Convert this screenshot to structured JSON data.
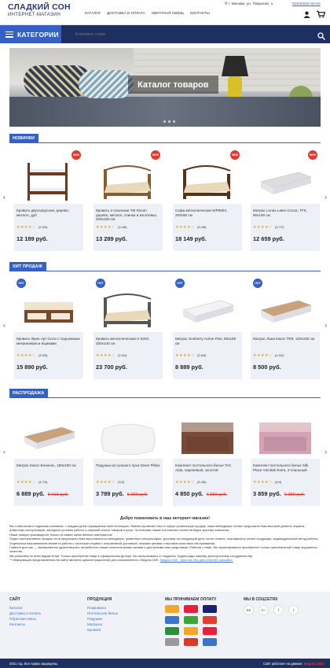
{
  "header": {
    "logo_title": "СЛАДКИЙ СОН",
    "logo_subtitle": "ИНТЕРНЕТ-МАГАЗИН",
    "nav": [
      "Каталог",
      "Доставка и оплата",
      "Обратная связь",
      "Контакты"
    ],
    "address": "г. Москва, ул. Тверская, 1.",
    "phone": "8(555)555-55-55"
  },
  "bar": {
    "categories_label": "КАТЕГОРИИ",
    "search_placeholder": "Ключевое слово"
  },
  "banner": {
    "title": "Каталог товаров"
  },
  "sections": [
    {
      "title": "НОВИНКИ",
      "badge": "NEW",
      "products": [
        {
          "name": "Кровать двухъярусная, дерево, металл, дуб",
          "rating": "★★★★☆",
          "reviews": "(2.5/4)",
          "price": "12 189 руб.",
          "old": ""
        },
        {
          "name": "Кровать 2-спальная ТМ Ricom дерево, металл, спинка и изголовье, 200x160 см",
          "rating": "★★★★☆",
          "reviews": "(3.4/8)",
          "price": "13 289 руб.",
          "old": ""
        },
        {
          "name": "Софа металлическая WP9003, 200х90 см",
          "rating": "★★★★☆",
          "reviews": "(3.4/8)",
          "price": "18 149 руб.",
          "old": ""
        },
        {
          "name": "Матрас Lonax Latex-Cocos, ТFK, 90х190 см",
          "rating": "★★★★☆",
          "reviews": "(3.7/7)",
          "price": "12 659 руб.",
          "old": ""
        }
      ]
    },
    {
      "title": "ХИТ ПРОДАЖ",
      "badge": "HOT",
      "products": [
        {
          "name": "Кровать Фран Арт-Сити с подъемным механизмом и ящиками",
          "rating": "★★★★☆",
          "reviews": "(3.5/5)",
          "price": "15 890 руб.",
          "old": ""
        },
        {
          "name": "Кровать металлическая Н 9203, 200х140 см",
          "rating": "★★★★☆",
          "reviews": "(3.3/4)",
          "price": "23 700 руб.",
          "old": ""
        },
        {
          "name": "Матрас Sonberry Active Plus, 90х195 см",
          "rating": "★★★★☆",
          "reviews": "(3.6/5)",
          "price": "8 889 руб.",
          "old": ""
        },
        {
          "name": "Матрас Лана Кокос ТФК, 120х190 см",
          "rating": "★★★★☆",
          "reviews": "(4.5/2)",
          "price": "8 500 руб.",
          "old": ""
        }
      ]
    },
    {
      "title": "РАСПРОДАЖА",
      "badge": "",
      "products": [
        {
          "name": "Матрас Кокос Боннель, 180х190 см",
          "rating": "★★★★☆",
          "reviews": "(4.7/3)",
          "price": "6 889 руб.",
          "old": "8 419 руб."
        },
        {
          "name": "Подушка из гусиного пуха Down Pillow",
          "rating": "★★★★☆",
          "reviews": "(3/3)",
          "price": "3 789 руб.",
          "old": "5 200 руб."
        },
        {
          "name": "Комплект постельного белья TAC Aida, сиреневый, золотой",
          "rating": "★★★★☆",
          "reviews": "(3.4/5)",
          "price": "4 850 руб.",
          "old": "6 250 руб."
        },
        {
          "name": "Комплект постельного белья Silk Place Vinnitde Extra, 2-спальный",
          "rating": "★★★★☆",
          "reviews": "(4/4)",
          "price": "3 859 руб.",
          "old": "6 250 руб."
        }
      ]
    }
  ],
  "welcome": {
    "title": "Добро пожаловать в наш интернет-магазин!",
    "lines": [
      "Мы стабильная и надежная компания, с каждым днем наращиваем свой потенциал. Имеем огромный опыт в сфере организации продаж, наши менеджеры готовы предложить Вам высокий уровень сервиса, грамотную консультацию, выгодные условия работы и широкий спектр товаров и услуг. За плечами наших постоянных клиентов видит крупные компании.",
      "Наши товары производятся только из самых качественных материалов!",
      "Отдел корпоративных продаж готов предложить Вам персонального менеджера, грамотную консультацию, доставку на следующий день после оплаты, сертификаты на все продукции, индивидуальный метод работы.",
      "Отдельным направлением является работа с частными лицами с оперативной доставкой, низкими ценами и высоким качеством обслуживания.",
      "Главное для нас — своевременно удовлетворить потребности наших клиентов всеми силами и доступными нам средствами. Работая с нами, Вы гарантированно приобретете только оригинальный товар подлинного качества.",
      "Мы работаем по всем видам оплат. Только приобретая товар в официальном дилере, Вы застрахованы от подделок. Будем рады нашему долгосрочному сотрудничеству."
    ],
    "note": "** Информация представленная на сайте является демонстрационной для ознакомления с Moguta.CMS.",
    "link": "Moguta.CMS - простая cms для интернет-магазина."
  },
  "footer": {
    "site_title": "САЙТ",
    "site_links": [
      "Каталог",
      "Доставка и оплата",
      "Обратная связь",
      "Контакты"
    ],
    "prod_title": "ПРОДУКЦИЯ",
    "prod_links": [
      "Покрывала",
      "Постельное белье",
      "Подушки",
      "Матрасы",
      "Кровати"
    ],
    "pay_title": "МЫ ПРИНИМАЕМ ОПЛАТУ",
    "pay_colors": [
      "#f4a62a",
      "#e9203a",
      "#1a1f71",
      "#3b74c9",
      "#3aa635",
      "#e33e2e",
      "#2e8f3a",
      "#f4a62a",
      "#e9203a",
      "#999999",
      "#d63b2e",
      "#3b74c9"
    ],
    "soc_title": "МЫ В СОЦСЕТЯХ",
    "social": [
      "ВК",
      "G+",
      "f",
      "t"
    ],
    "copyright": "2021 год. Все права защищены.",
    "powered": "Сайт работает на движке:",
    "brand": "Moguta.CMS"
  }
}
